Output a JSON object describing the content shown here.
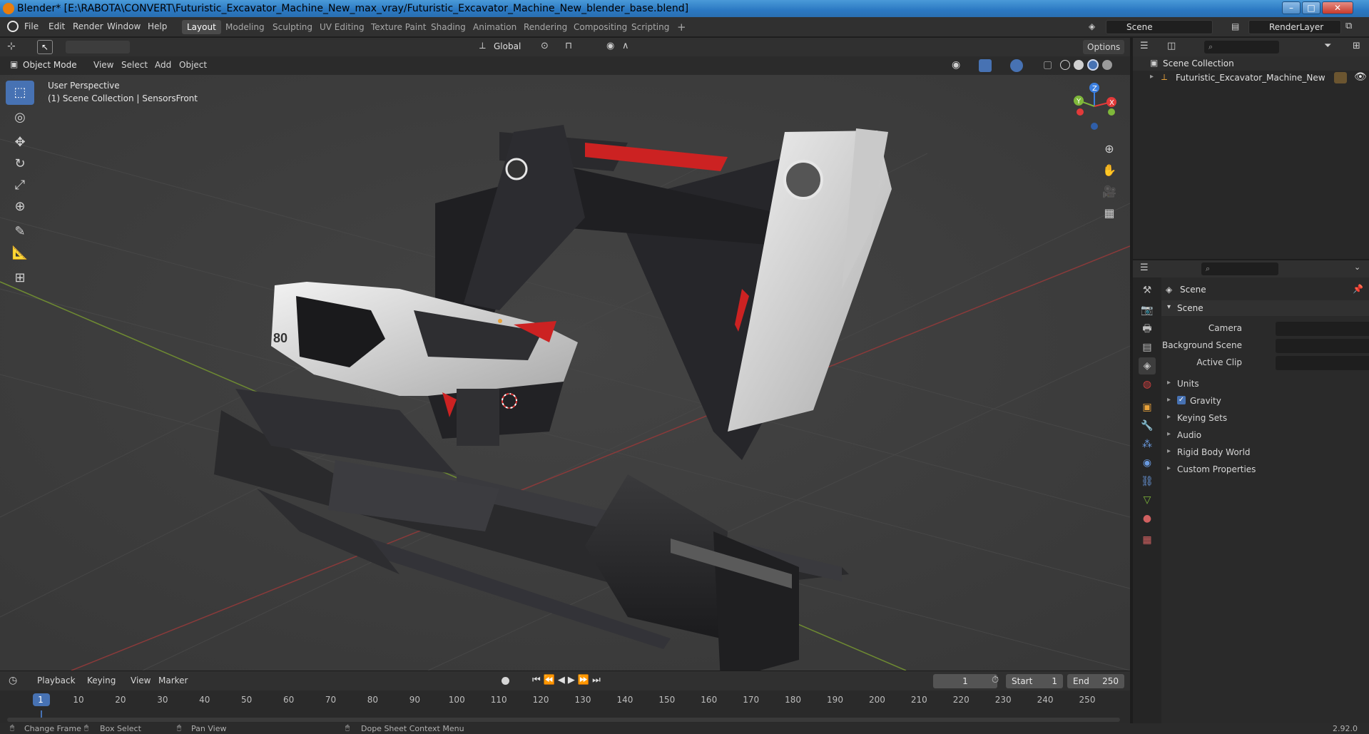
{
  "window": {
    "title": "Blender* [E:\\RABOTA\\CONVERT\\Futuristic_Excavator_Machine_New_max_vray/Futuristic_Excavator_Machine_New_blender_base.blend]",
    "minimize": "–",
    "maximize": "□",
    "close": "✕"
  },
  "menu": [
    "File",
    "Edit",
    "Render",
    "Window",
    "Help"
  ],
  "workspaces": [
    "Layout",
    "Modeling",
    "Sculpting",
    "UV Editing",
    "Texture Paint",
    "Shading",
    "Animation",
    "Rendering",
    "Compositing",
    "Scripting"
  ],
  "add_workspace": "+",
  "scene_field": "Scene",
  "renderlayer_field": "RenderLayer",
  "viewport": {
    "transform_orientation": "Global",
    "options_label": "Options",
    "mode": "Object Mode",
    "header_menu": [
      "View",
      "Select",
      "Add",
      "Object"
    ],
    "perspective_label": "User Perspective",
    "collection_label": "(1) Scene Collection | SensorsFront",
    "gizmo_axes": {
      "x": "X",
      "y": "Y",
      "z": "Z"
    },
    "model_badge": "80"
  },
  "tools": [
    "select-box",
    "cursor",
    "move",
    "rotate",
    "scale",
    "transform",
    "annotate",
    "measure",
    "add-cube"
  ],
  "nav_gizmos": [
    "zoom",
    "pan",
    "camera",
    "perspective-toggle"
  ],
  "outliner": {
    "root": "Scene Collection",
    "items": [
      {
        "label": "Futuristic_Excavator_Machine_New"
      }
    ]
  },
  "properties": {
    "context_label": "Scene",
    "panel_title": "Scene",
    "fields": [
      {
        "label": "Camera",
        "value": ""
      },
      {
        "label": "Background Scene",
        "value": ""
      },
      {
        "label": "Active Clip",
        "value": ""
      }
    ],
    "subpanels": [
      {
        "label": "Units",
        "checkbox": false
      },
      {
        "label": "Gravity",
        "checkbox": true
      },
      {
        "label": "Keying Sets",
        "checkbox": false
      },
      {
        "label": "Audio",
        "checkbox": false
      },
      {
        "label": "Rigid Body World",
        "checkbox": false
      },
      {
        "label": "Custom Properties",
        "checkbox": false
      }
    ]
  },
  "timeline": {
    "menu": [
      "Playback",
      "Keying",
      "View",
      "Marker"
    ],
    "current_frame": "1",
    "start_label": "Start",
    "start_value": "1",
    "end_label": "End",
    "end_value": "250",
    "ticks": [
      "1",
      "10",
      "20",
      "30",
      "40",
      "50",
      "60",
      "70",
      "80",
      "90",
      "100",
      "110",
      "120",
      "130",
      "140",
      "150",
      "160",
      "170",
      "180",
      "190",
      "200",
      "210",
      "220",
      "230",
      "240",
      "250"
    ]
  },
  "statusbar": {
    "items": [
      "Change Frame",
      "Box Select",
      "Pan View",
      "Dope Sheet Context Menu"
    ],
    "version": "2.92.0"
  },
  "colors": {
    "accent": "#4772b3",
    "axis_x": "#e23a3a",
    "axis_y": "#7fb83a",
    "axis_z": "#3b7fe0",
    "blender_orange": "#e87d0d"
  }
}
